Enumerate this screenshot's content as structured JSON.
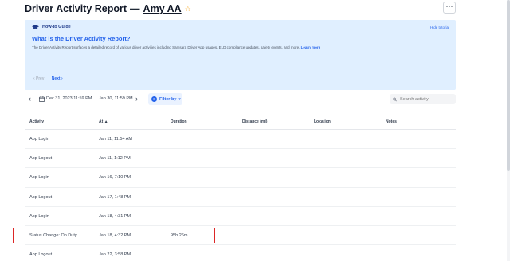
{
  "header": {
    "title": "Driver Activity Report",
    "separator": "—",
    "driver_name": "Amy AA",
    "star_icon": "☆",
    "more_label": "···"
  },
  "guide": {
    "label": "How-to Guide",
    "hide_label": "Hide tutorial",
    "title": "What is the Driver Activity Report?",
    "description": "The Driver Activity Report surfaces a detailed record of various driver activities including Samsara Driver App usages, ELD compliance updates, safety events, and more.",
    "learn_more": "Learn more",
    "prev_label": "‹ Prev",
    "next_label": "Next ›"
  },
  "toolbar": {
    "prev_icon": "‹",
    "next_icon": "›",
    "date_range": "Dec 31, 2023 11:59 PM → Jan 30, 11:59 PM",
    "filter_count": "0",
    "filter_label": "Filter by",
    "filter_caret": "▾",
    "search_placeholder": "Search activity"
  },
  "table": {
    "columns": [
      "Activity",
      "At ▲",
      "Duration",
      "Distance (mi)",
      "Location",
      "Notes"
    ],
    "rows": [
      [
        "App Login",
        "Jan 11, 11:54 AM",
        "",
        "",
        "",
        ""
      ],
      [
        "App Logout",
        "Jan 11, 1:12 PM",
        "",
        "",
        "",
        ""
      ],
      [
        "App Login",
        "Jan 16, 7:10 PM",
        "",
        "",
        "",
        ""
      ],
      [
        "App Logout",
        "Jan 17, 1:48 PM",
        "",
        "",
        "",
        ""
      ],
      [
        "App Login",
        "Jan 18, 4:31 PM",
        "",
        "",
        "",
        ""
      ],
      [
        "Status Change: On Duty",
        "Jan 18, 4:32 PM",
        "95h 26m",
        "",
        "",
        ""
      ],
      [
        "App Logout",
        "Jan 22, 3:58 PM",
        "",
        "",
        "",
        ""
      ]
    ]
  },
  "colors": {
    "accent": "#2563eb",
    "guide_bg": "#e0efff",
    "highlight": "#dc2626",
    "star": "#f59e0b"
  }
}
